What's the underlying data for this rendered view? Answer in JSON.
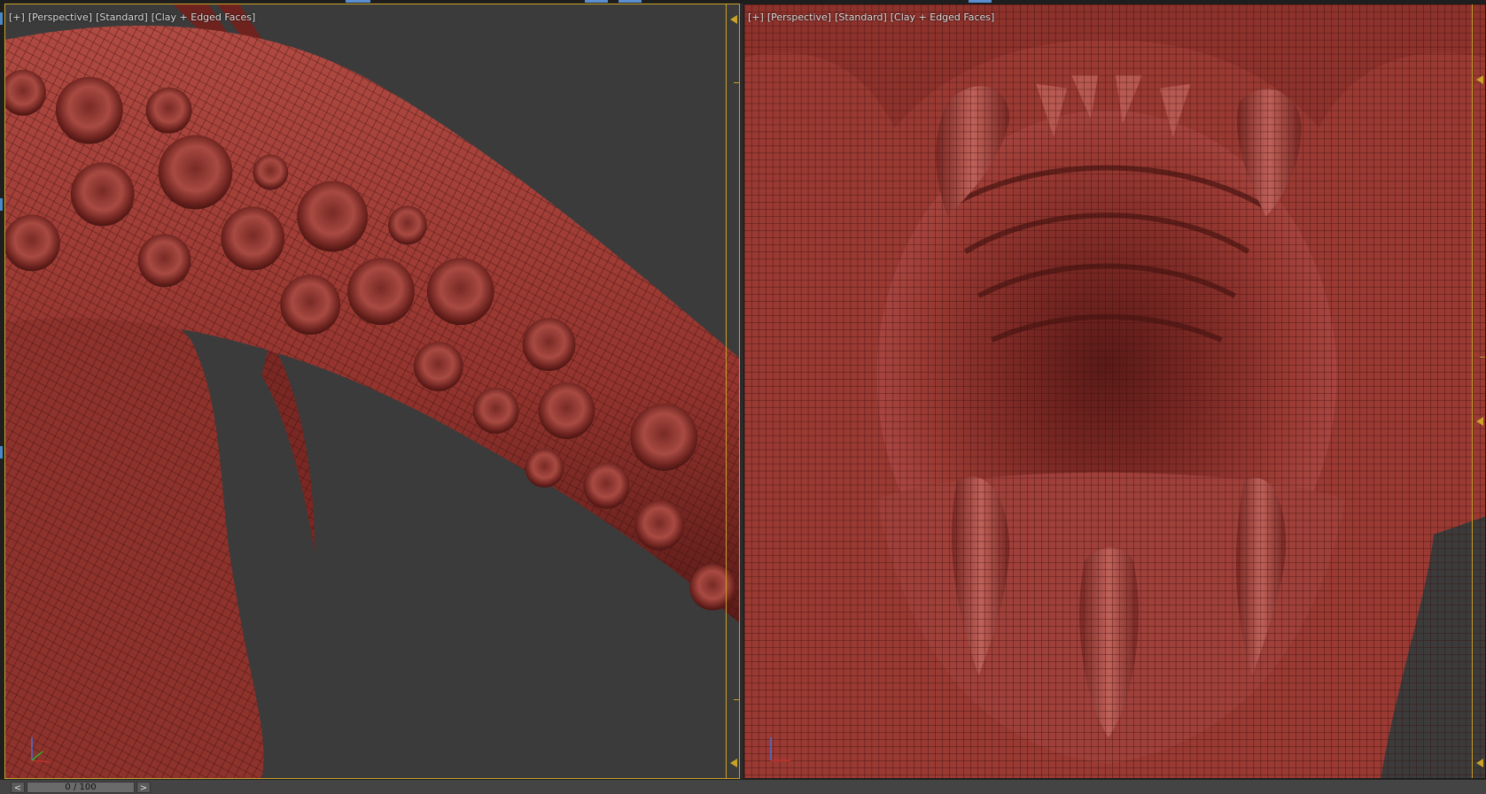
{
  "viewports": {
    "left": {
      "label": {
        "plus": "[+]",
        "view": "[Perspective]",
        "shading": "[Standard]",
        "mode": "[Clay + Edged Faces]"
      }
    },
    "right": {
      "label": {
        "plus": "[+]",
        "view": "[Perspective]",
        "shading": "[Standard]",
        "mode": "[Clay + Edged Faces]"
      }
    }
  },
  "timeline": {
    "prev_label": "<",
    "next_label": ">",
    "frame_readout": "0 / 100"
  },
  "colors": {
    "active_border": "#c9a227",
    "clay": "#9a3a33",
    "wire": "#3a0f0c",
    "background": "#3b3b3b"
  },
  "icons": {
    "axis": "xyz-axis-gizmo-icon",
    "scroll_marker": "triangle-marker-icon"
  }
}
